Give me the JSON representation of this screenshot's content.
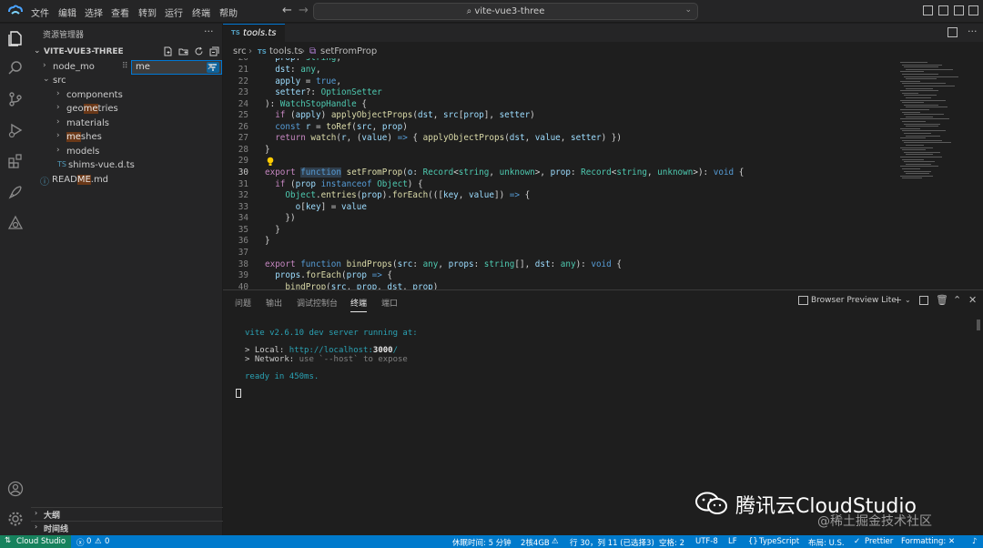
{
  "menu": [
    "文件",
    "编辑",
    "选择",
    "查看",
    "转到",
    "运行",
    "终端",
    "帮助"
  ],
  "command_center": "vite-vue3-three",
  "sidebar": {
    "header": "资源管理器",
    "project": "VITE-VUE3-THREE",
    "tree": [
      {
        "name_pre": "node_mo",
        "name_hl": "",
        "name_post": "",
        "kind": "folder",
        "level": 0
      },
      {
        "name_pre": "src",
        "name_hl": "",
        "name_post": "",
        "kind": "folder-open",
        "level": 0
      },
      {
        "name_pre": "components",
        "name_hl": "",
        "name_post": "",
        "kind": "folder",
        "level": 1
      },
      {
        "name_pre": "geo",
        "name_hl": "me",
        "name_post": "tries",
        "kind": "folder",
        "level": 1
      },
      {
        "name_pre": "materials",
        "name_hl": "",
        "name_post": "",
        "kind": "folder",
        "level": 1
      },
      {
        "name_pre": "",
        "name_hl": "me",
        "name_post": "shes",
        "kind": "folder",
        "level": 1
      },
      {
        "name_pre": "models",
        "name_hl": "",
        "name_post": "",
        "kind": "folder",
        "level": 1
      },
      {
        "name_pre": "shims-vue.d.ts",
        "name_hl": "",
        "name_post": "",
        "kind": "ts-file",
        "level": 1
      },
      {
        "name_pre": "READ",
        "name_hl": "ME",
        "name_post": ".md",
        "kind": "info-file",
        "level": 0
      }
    ],
    "find_value": "me",
    "outline": "大纲",
    "timeline": "时间线"
  },
  "tab": {
    "badge": "TS",
    "name": "tools.ts"
  },
  "breadcrumb": {
    "part1": "src",
    "badge": "TS",
    "part2": "tools.ts",
    "part3": "setFromProp"
  },
  "code": [
    {
      "n": "21",
      "html": "  <span class='v'>dst</span>: <span class='t'>any</span>,"
    },
    {
      "n": "22",
      "html": "  <span class='v'>apply</span> = <span class='k'>true</span>,"
    },
    {
      "n": "23",
      "html": "  <span class='v'>setter</span>?: <span class='t'>OptionSetter</span>"
    },
    {
      "n": "24",
      "html": "): <span class='t'>WatchStopHandle</span> {"
    },
    {
      "n": "25",
      "html": "  <span class='kc'>if</span> (<span class='v'>apply</span>) <span class='f'>applyObjectProps</span>(<span class='v'>dst</span>, <span class='v'>src</span>[<span class='v'>prop</span>], <span class='v'>setter</span>)"
    },
    {
      "n": "26",
      "html": "  <span class='k'>const</span> <span class='v'>r</span> = <span class='f'>toRef</span>(<span class='v'>src</span>, <span class='v'>prop</span>)"
    },
    {
      "n": "27",
      "html": "  <span class='kc'>return</span> <span class='f'>watch</span>(<span class='v'>r</span>, (<span class='v'>value</span>) <span class='k'>=&gt;</span> { <span class='f'>applyObjectProps</span>(<span class='v'>dst</span>, <span class='v'>value</span>, <span class='v'>setter</span>) })"
    },
    {
      "n": "28",
      "html": "}"
    },
    {
      "n": "29",
      "html": ""
    },
    {
      "n": "30",
      "html": "<span class='kc'>export</span> <span class='k fnhl'>function</span> <span class='f'>setFromProp</span>(<span class='v'>o</span>: <span class='t'>Record</span>&lt;<span class='t'>string</span>, <span class='t'>unknown</span>&gt;, <span class='v'>prop</span>: <span class='t'>Record</span>&lt;<span class='t'>string</span>, <span class='t'>unknown</span>&gt;): <span class='k'>void</span> {"
    },
    {
      "n": "31",
      "html": "  <span class='kc'>if</span> (<span class='v'>prop</span> <span class='k'>instanceof</span> <span class='t'>Object</span>) {"
    },
    {
      "n": "32",
      "html": "    <span class='t'>Object</span>.<span class='f'>entries</span>(<span class='v'>prop</span>).<span class='f'>forEach</span>(([<span class='v'>key</span>, <span class='v'>value</span>]) <span class='k'>=&gt;</span> {"
    },
    {
      "n": "33",
      "html": "      <span class='v'>o</span>[<span class='v'>key</span>] = <span class='v'>value</span>"
    },
    {
      "n": "34",
      "html": "    })"
    },
    {
      "n": "35",
      "html": "  }"
    },
    {
      "n": "36",
      "html": "}"
    },
    {
      "n": "37",
      "html": ""
    },
    {
      "n": "38",
      "html": "<span class='kc'>export</span> <span class='k'>function</span> <span class='f'>bindProps</span>(<span class='v'>src</span>: <span class='t'>any</span>, <span class='v'>props</span>: <span class='t'>string</span>[], <span class='v'>dst</span>: <span class='t'>any</span>): <span class='k'>void</span> {"
    },
    {
      "n": "39",
      "html": "  <span class='v'>props</span>.<span class='f'>forEach</span>(<span class='v'>prop</span> <span class='k'>=&gt;</span> {"
    }
  ],
  "panel": {
    "tabs": [
      "问题",
      "输出",
      "调试控制台",
      "终端",
      "端口"
    ],
    "active_tab": "终端",
    "browser_preview": "Browser Preview Lite",
    "terminal": {
      "line1_a": "vite ",
      "line1_b": "v2.6.10",
      "line1_c": " dev server running at:",
      "local_label": "> Local: ",
      "local_url_a": "http://localhost:",
      "local_url_port": "3000",
      "local_url_c": "/",
      "network_label": "> Network: ",
      "network_text_a": "use ",
      "network_text_b": "`--host`",
      "network_text_c": " to expose",
      "ready_a": "ready in ",
      "ready_b": "450ms",
      "ready_c": "."
    }
  },
  "watermark": {
    "brand": "腾讯云CloudStudio",
    "sub": "@稀土掘金技术社区"
  },
  "statusbar": {
    "remote": "Cloud Studio",
    "errors": "0",
    "warnings": "0",
    "rest": "休眠时间: 5 分钟",
    "machine": "2核4GB",
    "position": "行 30，列 11 (已选择3)",
    "indent": "空格: 2",
    "encoding": "UTF-8",
    "eol": "LF",
    "language": "TypeScript",
    "layout": "布局: U.S.",
    "prettier": "Prettier",
    "formatting": "Formatting: ✕"
  },
  "colors": {
    "accent": "#007acc",
    "remote": "#16825d",
    "highlight": "#ea5c00"
  }
}
